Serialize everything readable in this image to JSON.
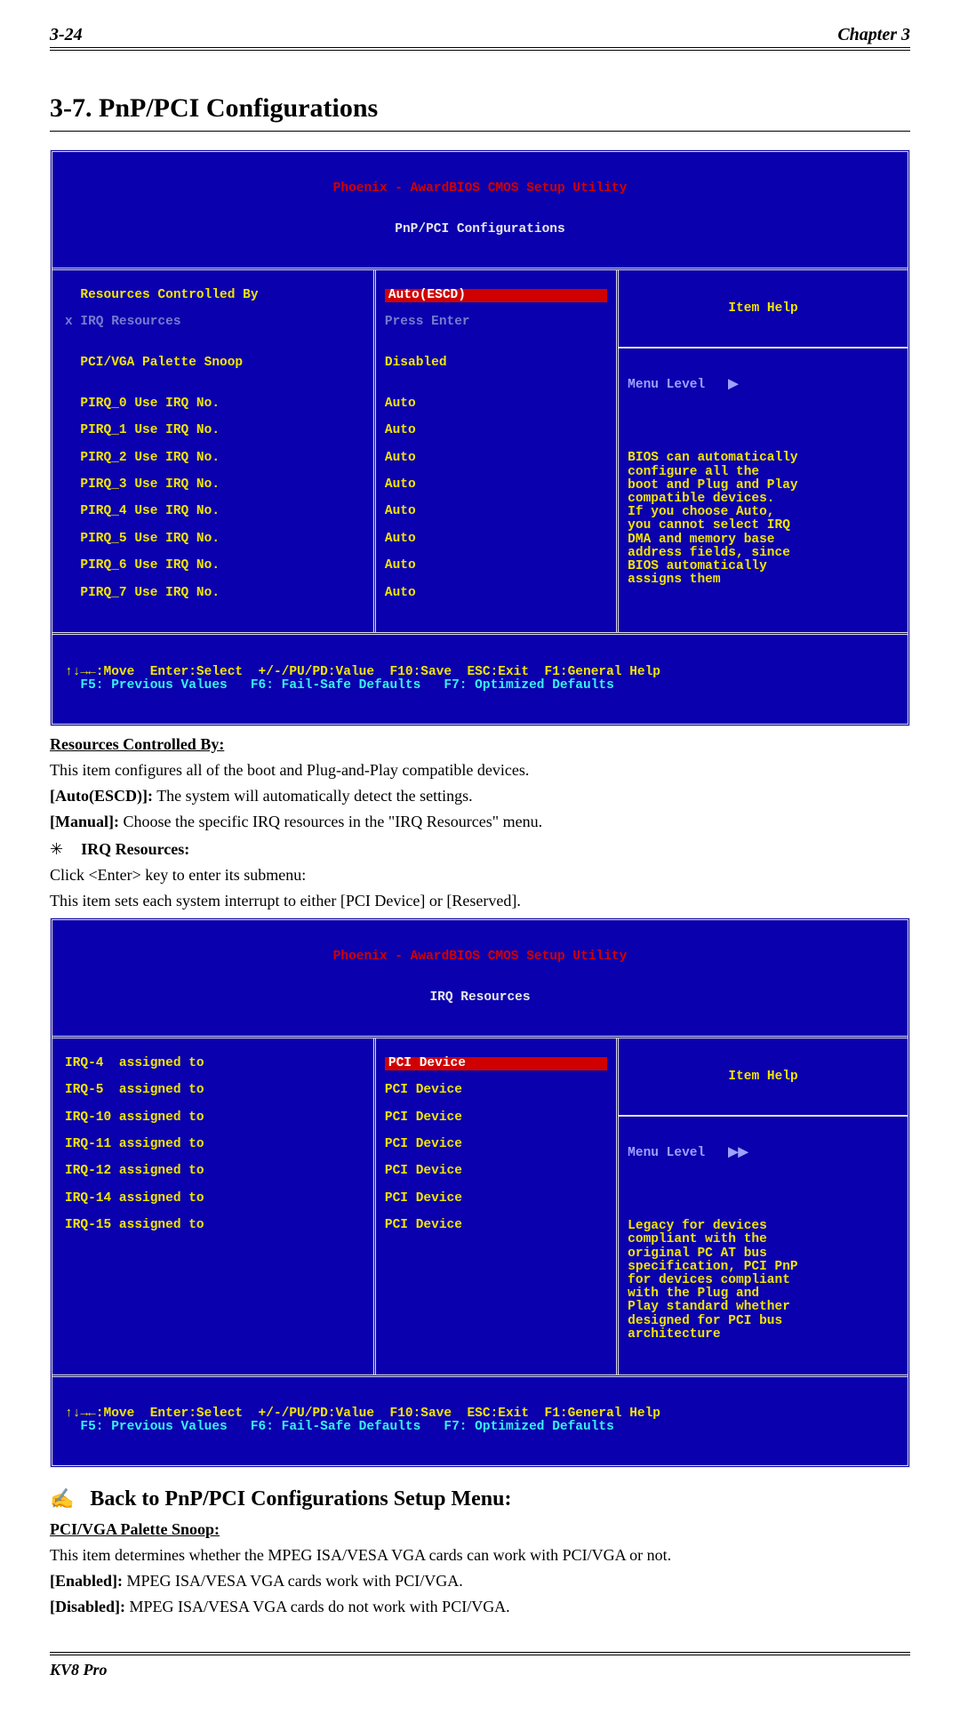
{
  "header": {
    "page_num": "3-24",
    "chapter": "Chapter 3"
  },
  "section": {
    "number_title": "3-7.  PnP/PCI Configurations"
  },
  "bios1": {
    "title": "Phoenix - AwardBIOS CMOS Setup Utility",
    "subtitle": "PnP/PCI Configurations",
    "left_lines": [
      "  Resources Controlled By",
      "x IRQ Resources",
      "",
      "  PCI/VGA Palette Snoop",
      "",
      "  PIRQ_0 Use IRQ No.",
      "  PIRQ_1 Use IRQ No.",
      "  PIRQ_2 Use IRQ No.",
      "  PIRQ_3 Use IRQ No.",
      "  PIRQ_4 Use IRQ No.",
      "  PIRQ_5 Use IRQ No.",
      "  PIRQ_6 Use IRQ No.",
      "  PIRQ_7 Use IRQ No."
    ],
    "mid_lines": [
      "Auto(ESCD)",
      "Press Enter",
      "",
      "Disabled",
      "",
      "Auto",
      "Auto",
      "Auto",
      "Auto",
      "Auto",
      "Auto",
      "Auto",
      "Auto"
    ],
    "help_title": "Item Help",
    "menu_level": "Menu Level   ▶",
    "help_body": "BIOS can automatically\nconfigure all the\nboot and Plug and Play\ncompatible devices.\nIf you choose Auto,\nyou cannot select IRQ\nDMA and memory base\naddress fields, since\nBIOS automatically\nassigns them",
    "footer1": "↑↓→←:Move  Enter:Select  +/-/PU/PD:Value  F10:Save  ESC:Exit  F1:General Help",
    "footer2": "  F5: Previous Values   F6: Fail-Safe Defaults   F7: Optimized Defaults"
  },
  "body1": {
    "h_resources": "Resources Controlled By:",
    "p1": "This item configures all of the boot and Plug-and-Play compatible devices.",
    "auto_label": "[Auto(ESCD)]:",
    "auto_text": " The system will automatically detect the settings.",
    "manual_label": "[Manual]:",
    "manual_text": " Choose the specific IRQ resources in the \"IRQ Resources\" menu.",
    "irq_bullet": "✳",
    "irq_title": "IRQ Resources:",
    "click_enter": "Click <Enter> key to enter its submenu:",
    "p_sets": "This item sets each system interrupt to either [PCI Device] or [Reserved]."
  },
  "bios2": {
    "title": "Phoenix - AwardBIOS CMOS Setup Utility",
    "subtitle": "IRQ Resources",
    "left_lines": [
      "IRQ-4  assigned to",
      "IRQ-5  assigned to",
      "IRQ-10 assigned to",
      "IRQ-11 assigned to",
      "IRQ-12 assigned to",
      "IRQ-14 assigned to",
      "IRQ-15 assigned to"
    ],
    "mid_lines": [
      "PCI Device",
      "PCI Device",
      "PCI Device",
      "PCI Device",
      "PCI Device",
      "PCI Device",
      "PCI Device"
    ],
    "help_title": "Item Help",
    "menu_level": "Menu Level   ▶▶",
    "help_body": "Legacy for devices\ncompliant with the\noriginal PC AT bus\nspecification, PCI PnP\nfor devices compliant\nwith the Plug and\nPlay standard whether\ndesigned for PCI bus\narchitecture",
    "footer1": "↑↓→←:Move  Enter:Select  +/-/PU/PD:Value  F10:Save  ESC:Exit  F1:General Help",
    "footer2": "  F5: Previous Values   F6: Fail-Safe Defaults   F7: Optimized Defaults"
  },
  "back": {
    "hand": "✍",
    "title": "Back to PnP/PCI Configurations Setup Menu:"
  },
  "body2": {
    "h_snoop": "PCI/VGA Palette Snoop:",
    "p_snoop": "This item determines whether the MPEG ISA/VESA VGA cards can work with PCI/VGA or not.",
    "enabled_label": "[Enabled]:",
    "enabled_text": " MPEG ISA/VESA VGA cards work with PCI/VGA.",
    "disabled_label": "[Disabled]:",
    "disabled_text": " MPEG ISA/VESA VGA cards do not work with PCI/VGA."
  },
  "footer": {
    "product": "KV8 Pro"
  }
}
